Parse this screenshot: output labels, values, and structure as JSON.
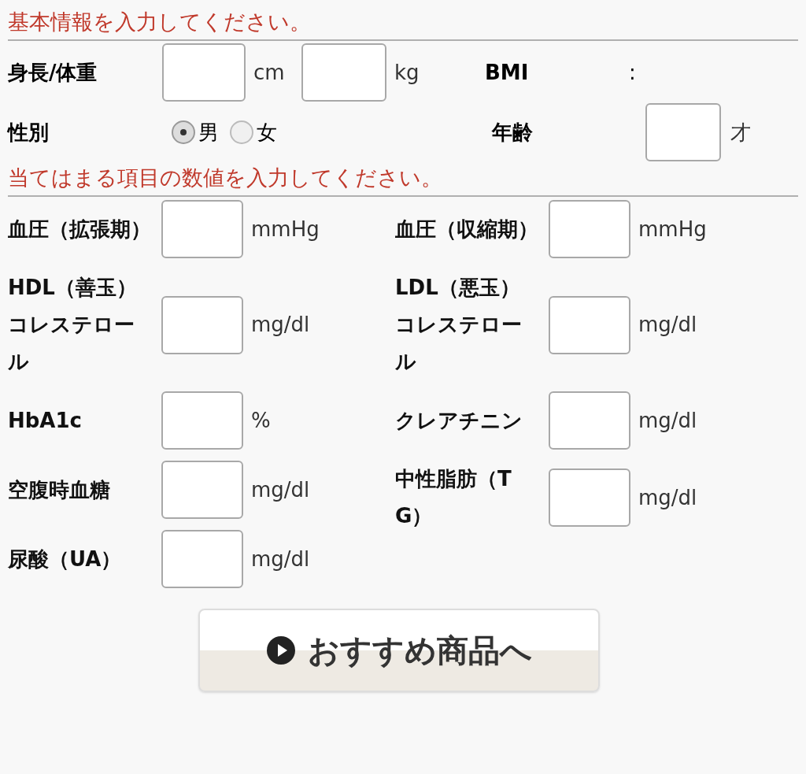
{
  "basic": {
    "heading": "基本情報を入力してください。",
    "height_weight": {
      "label": "身長/体重",
      "height_unit": "cm",
      "weight_unit": "kg"
    },
    "bmi": {
      "label": "BMI",
      "separator": ":"
    },
    "sex": {
      "label": "性別",
      "options": [
        {
          "label": "男",
          "selected": true
        },
        {
          "label": "女",
          "selected": false
        }
      ]
    },
    "age": {
      "label": "年齢",
      "unit": "才"
    }
  },
  "values": {
    "heading": "当てはまる項目の数値を入力してください。",
    "left": [
      {
        "label": "血圧（拡張期）",
        "unit": "mmHg"
      },
      {
        "label": "HDL（善玉）コレステロール",
        "unit": "mg/dl"
      },
      {
        "label": "HbA1c",
        "unit": "%"
      },
      {
        "label": "空腹時血糖",
        "unit": "mg/dl"
      },
      {
        "label": "尿酸（UA）",
        "unit": "mg/dl"
      }
    ],
    "right": [
      {
        "label": "血圧（収縮期）",
        "unit": "mmHg"
      },
      {
        "label": "LDL（悪玉）コレステロール",
        "unit": "mg/dl"
      },
      {
        "label": "クレアチニン",
        "unit": "mg/dl"
      },
      {
        "label": "中性脂肪（TG）",
        "unit": "mg/dl"
      }
    ]
  },
  "submit": {
    "label": "おすすめ商品へ"
  }
}
